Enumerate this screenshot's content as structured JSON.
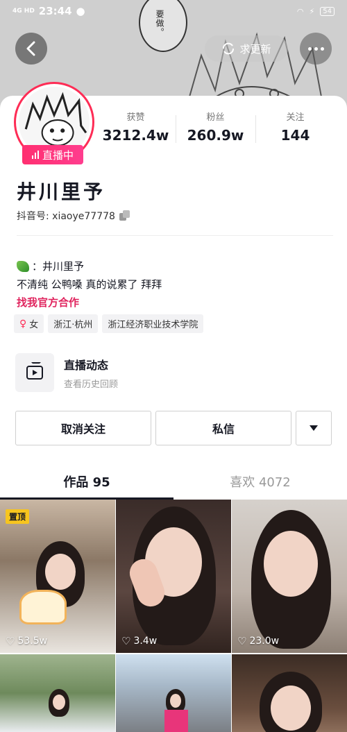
{
  "status_bar": {
    "network": "4G HD",
    "time": "23:44",
    "battery": "54"
  },
  "header": {
    "refresh_label": "求更新"
  },
  "profile": {
    "live_badge": "直播中",
    "stats": [
      {
        "label": "获赞",
        "value": "3212.4w"
      },
      {
        "label": "粉丝",
        "value": "260.9w"
      },
      {
        "label": "关注",
        "value": "144"
      }
    ],
    "nickname": "井川里予",
    "douyin_id": "抖音号: xiaoye77778",
    "bio": {
      "line1": "：井川里予",
      "line2": "不清纯 公鸭嗓 真的说累了 拜拜",
      "link": "找我官方合作"
    },
    "tags": [
      {
        "icon": "♀",
        "text": "女"
      },
      {
        "text": "浙江·杭州"
      },
      {
        "text": "浙江经济职业技术学院"
      }
    ]
  },
  "live_entry": {
    "title": "直播动态",
    "subtitle": "查看历史回顾"
  },
  "actions": {
    "unfollow": "取消关注",
    "message": "私信"
  },
  "tabs": [
    {
      "label": "作品 95",
      "active": true
    },
    {
      "label": "喜欢 4072",
      "active": false
    }
  ],
  "videos": [
    {
      "pinned": "置顶",
      "likes": "53.5w"
    },
    {
      "likes": "3.4w"
    },
    {
      "likes": "23.0w"
    }
  ],
  "banner_bubble_text": "要做。"
}
